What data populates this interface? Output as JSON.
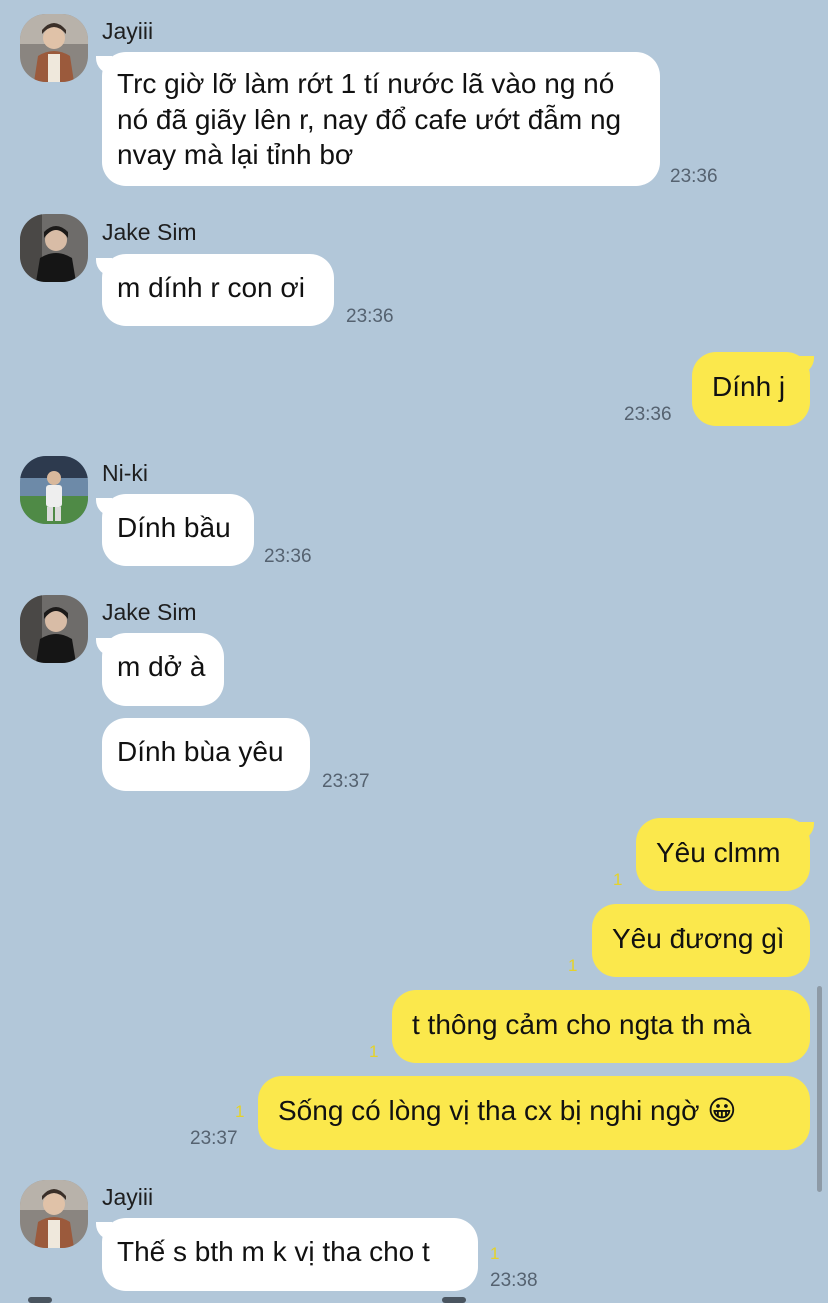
{
  "app": {
    "name": "group-chat"
  },
  "colors": {
    "background": "#b2c7d9",
    "incoming_bubble": "#ffffff",
    "outgoing_bubble": "#fbe84c",
    "unread_count": "#e5d22a",
    "timestamp": "#556270"
  },
  "messages": [
    {
      "sender": "Jayiii",
      "text": "Trc giờ lỡ làm rớt 1 tí nước lã vào ng nó nó đã giãy lên r, nay đổ cafe ướt đẫm ng nvay mà lại tỉnh bơ",
      "time": "23:36"
    },
    {
      "sender": "Jake Sim",
      "text": "m dính r con ơi",
      "time": "23:36"
    },
    {
      "sender": "me",
      "text": "Dính j",
      "time": "23:36"
    },
    {
      "sender": "Ni-ki",
      "text": "Dính bầu",
      "time": "23:36"
    },
    {
      "sender": "Jake Sim",
      "text": "m dở à"
    },
    {
      "sender": "Jake Sim",
      "text": "Dính bùa yêu",
      "time": "23:37"
    },
    {
      "sender": "me",
      "text": "Yêu clmm",
      "unread": "1"
    },
    {
      "sender": "me",
      "text": "Yêu đương gì",
      "unread": "1"
    },
    {
      "sender": "me",
      "text": "t thông cảm cho ngta th mà",
      "unread": "1"
    },
    {
      "sender": "me",
      "text": "Sống có lòng vị tha cx bị nghi ngờ 😀",
      "unread": "1",
      "time": "23:37"
    },
    {
      "sender": "Jayiii",
      "text": "Thế s bth m k vị tha cho t",
      "unread": "1",
      "time": "23:38"
    }
  ]
}
